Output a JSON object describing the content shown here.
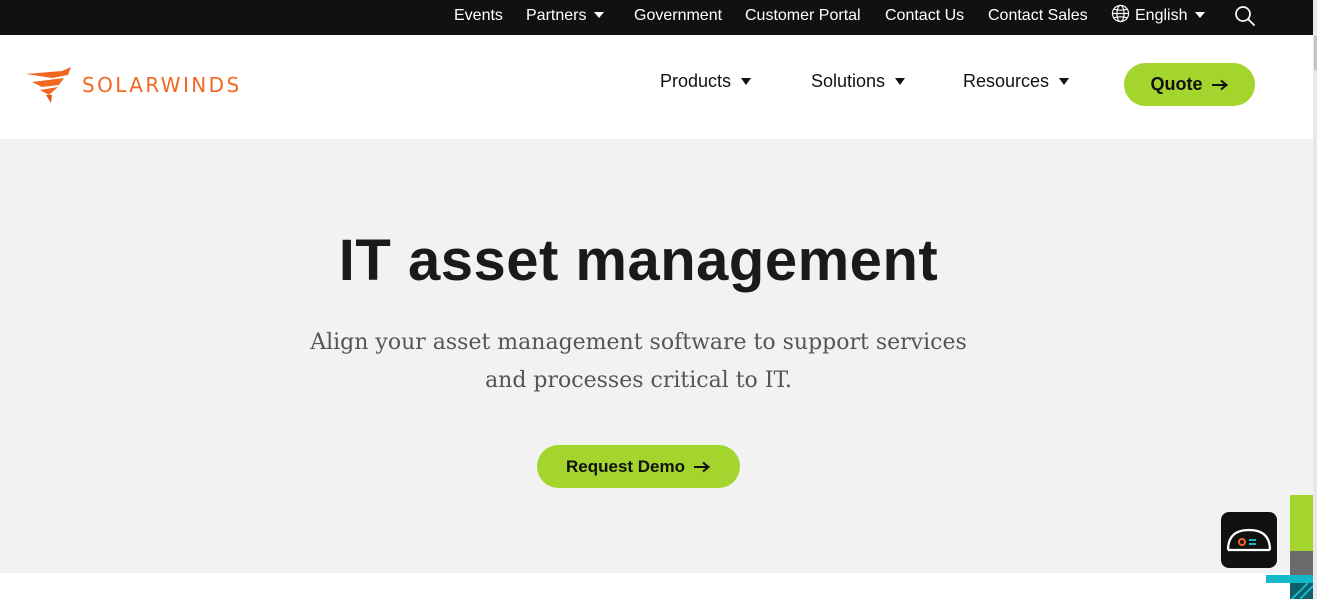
{
  "topbar": {
    "items": [
      "Events",
      "Partners",
      "Government",
      "Customer Portal",
      "Contact Us",
      "Contact Sales"
    ],
    "language": "English"
  },
  "brand": {
    "name": "SOLARWINDS",
    "color": "#f26722"
  },
  "nav": {
    "items": [
      "Products",
      "Solutions",
      "Resources"
    ],
    "quote_label": "Quote"
  },
  "hero": {
    "title": "IT asset management",
    "subtitle_line1": "Align your asset management software to support services",
    "subtitle_line2": "and processes critical to IT.",
    "cta_label": "Request Demo"
  },
  "colors": {
    "topbar_bg": "#111111",
    "accent_green": "#a3d52e",
    "hero_bg": "#f1f2f1",
    "teal": "#13b9c9"
  },
  "icons": {
    "globe": "globe-icon",
    "search": "search-icon",
    "arrow": "arrow-right-icon",
    "chat": "chat-widget-icon"
  }
}
